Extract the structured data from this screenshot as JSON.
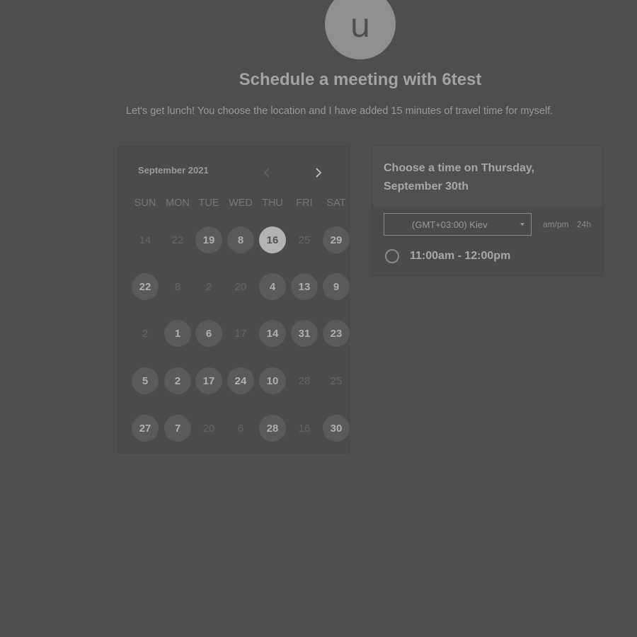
{
  "header": {
    "avatar_letter": "u",
    "title": "Schedule a meeting with 6test",
    "subtitle": "Let's get lunch! You choose the location and I have added 15 minutes of travel time for myself."
  },
  "calendar": {
    "month_label": "September 2021",
    "prev_icon": "chevron-left-icon",
    "next_icon": "chevron-right-icon",
    "weekdays": [
      "SUN",
      "MON",
      "TUE",
      "WED",
      "THU",
      "FRI",
      "SAT"
    ],
    "weeks": [
      [
        {
          "label": "14",
          "state": "unavailable"
        },
        {
          "label": "22",
          "state": "unavailable"
        },
        {
          "label": "19",
          "state": "available"
        },
        {
          "label": "8",
          "state": "available"
        },
        {
          "label": "16",
          "state": "selected"
        },
        {
          "label": "25",
          "state": "unavailable"
        },
        {
          "label": "29",
          "state": "available"
        }
      ],
      [
        {
          "label": "22",
          "state": "available"
        },
        {
          "label": "8",
          "state": "unavailable"
        },
        {
          "label": "2",
          "state": "unavailable"
        },
        {
          "label": "20",
          "state": "unavailable"
        },
        {
          "label": "4",
          "state": "available"
        },
        {
          "label": "13",
          "state": "available"
        },
        {
          "label": "9",
          "state": "available"
        }
      ],
      [
        {
          "label": "2",
          "state": "unavailable"
        },
        {
          "label": "1",
          "state": "available"
        },
        {
          "label": "6",
          "state": "available"
        },
        {
          "label": "17",
          "state": "unavailable"
        },
        {
          "label": "14",
          "state": "available"
        },
        {
          "label": "31",
          "state": "available"
        },
        {
          "label": "23",
          "state": "available"
        }
      ],
      [
        {
          "label": "5",
          "state": "available"
        },
        {
          "label": "2",
          "state": "available"
        },
        {
          "label": "17",
          "state": "available"
        },
        {
          "label": "24",
          "state": "available"
        },
        {
          "label": "10",
          "state": "available"
        },
        {
          "label": "28",
          "state": "unavailable"
        },
        {
          "label": "25",
          "state": "unavailable"
        }
      ],
      [
        {
          "label": "27",
          "state": "available"
        },
        {
          "label": "7",
          "state": "available"
        },
        {
          "label": "20",
          "state": "unavailable"
        },
        {
          "label": "6",
          "state": "unavailable"
        },
        {
          "label": "28",
          "state": "available"
        },
        {
          "label": "16",
          "state": "unavailable"
        },
        {
          "label": "30",
          "state": "available"
        }
      ]
    ]
  },
  "times": {
    "heading": "Choose a time on Thursday, September 30th",
    "timezone": "(GMT+03:00) Kiev",
    "format_ampm": "am/pm",
    "format_24h": "24h",
    "slots": [
      {
        "label": "11:00am - 12:00pm"
      }
    ]
  },
  "colors": {
    "background": "#4e4e4e",
    "selected_day": "#b3b3b3",
    "available_day": "#5a5a5a"
  }
}
